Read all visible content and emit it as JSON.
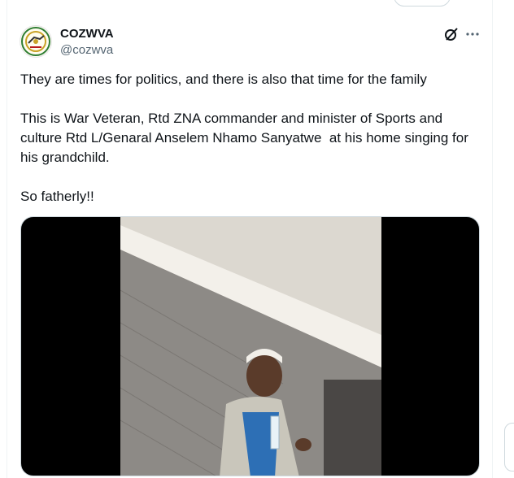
{
  "account": {
    "display_name": "COZWVA",
    "handle": "@cozwva",
    "avatar_icon": "cozwva-logo"
  },
  "tweet": {
    "paragraphs": [
      "They are times for politics, and there is also that time for the family",
      "This is War Veteran, Rtd ZNA commander and minister of Sports and culture Rtd L/Genaral Anselem Nhamo Sanyatwe  at his home singing for his grandchild.",
      "So fatherly!!"
    ]
  },
  "icons": {
    "grok": "grok-icon",
    "more": "more-options-icon"
  },
  "colors": {
    "text_primary": "#0f1419",
    "text_secondary": "#536471",
    "border": "#cfd9de",
    "media_bg": "#000000"
  }
}
